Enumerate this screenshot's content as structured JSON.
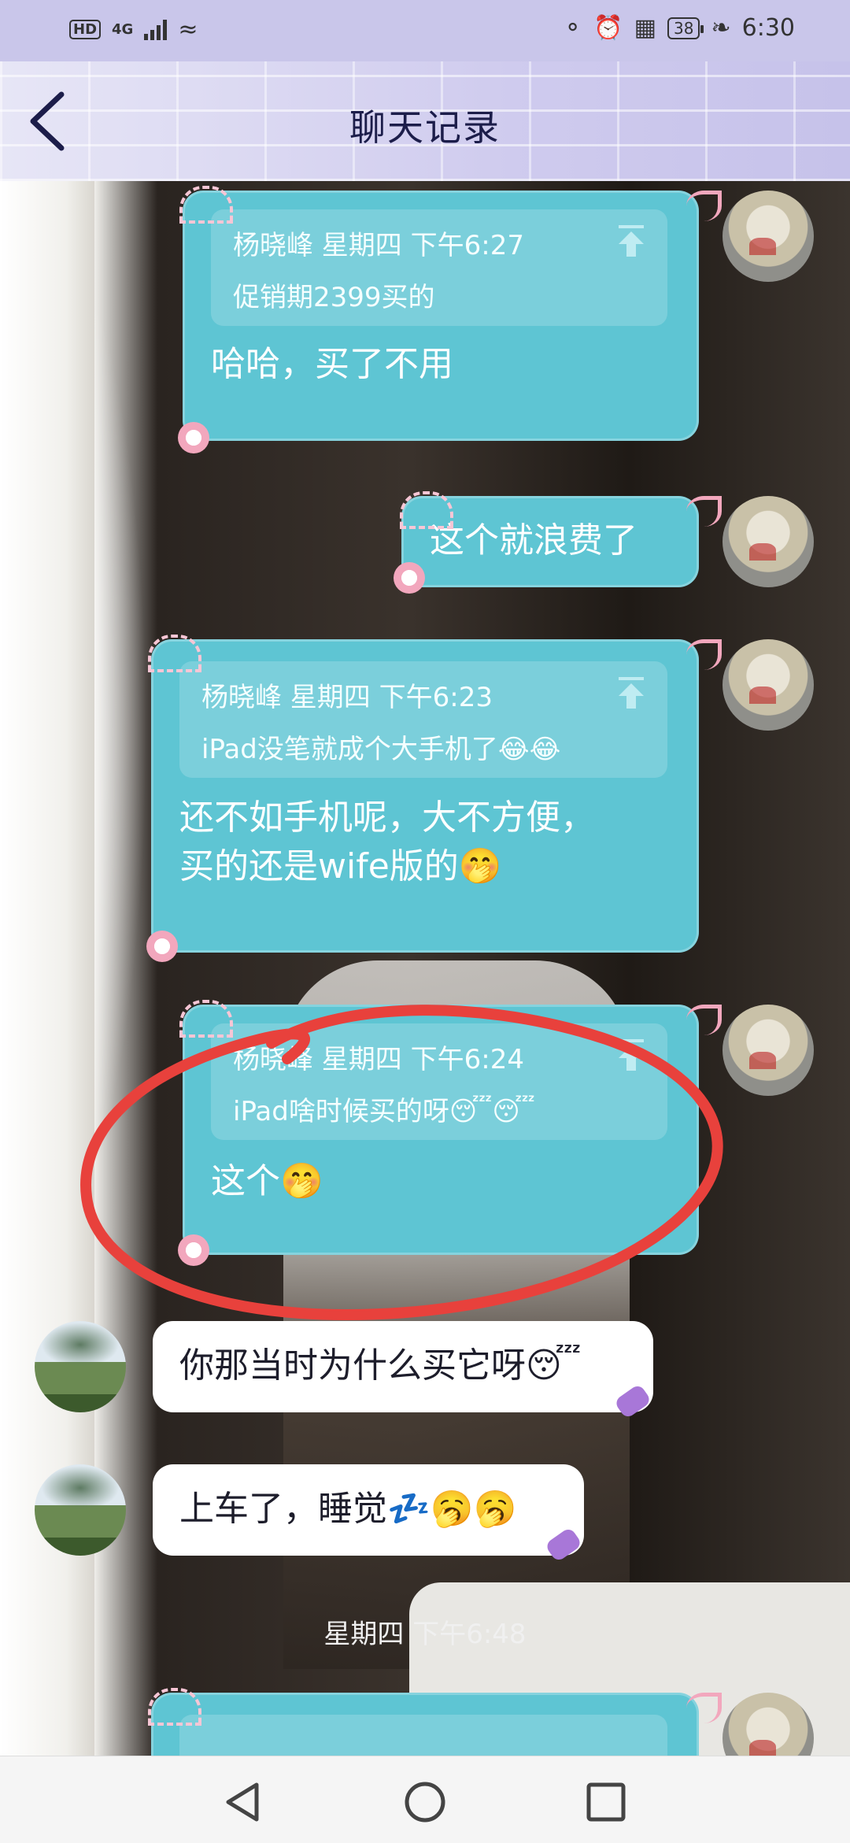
{
  "status": {
    "left_badge": "HD",
    "network": "4G",
    "time": "6:30",
    "battery": "38"
  },
  "header": {
    "title": "聊天记录"
  },
  "messages": [
    {
      "side": "me",
      "quote_meta": "杨晓峰 星期四 下午6:27",
      "quote_text": "促销期2399买的",
      "text": "哈哈，买了不用"
    },
    {
      "side": "me",
      "text": "这个就浪费了"
    },
    {
      "side": "me",
      "quote_meta": "杨晓峰 星期四 下午6:23",
      "quote_text": "iPad没笔就成个大手机了😂😂",
      "text": "还不如手机呢，大不方便，\n买的还是wife版的🤭"
    },
    {
      "side": "me",
      "quote_meta": "杨晓峰 星期四 下午6:24",
      "quote_text": "iPad啥时候买的呀😴😴",
      "text": "这个🤭"
    },
    {
      "side": "friend",
      "text": "你那当时为什么买它呀😴"
    },
    {
      "side": "friend",
      "text": "上车了，睡觉💤🥱🥱"
    }
  ],
  "timestamp": "星期四 下午6:48",
  "colors": {
    "bubble": "#5ec5d3",
    "annotation": "#e8413c",
    "header": "#c9c6ea"
  },
  "icons": {
    "back": "chevron-left-icon",
    "pin": "pin-to-top-icon",
    "nav": [
      "back-triangle-icon",
      "home-circle-icon",
      "recents-square-icon"
    ]
  }
}
